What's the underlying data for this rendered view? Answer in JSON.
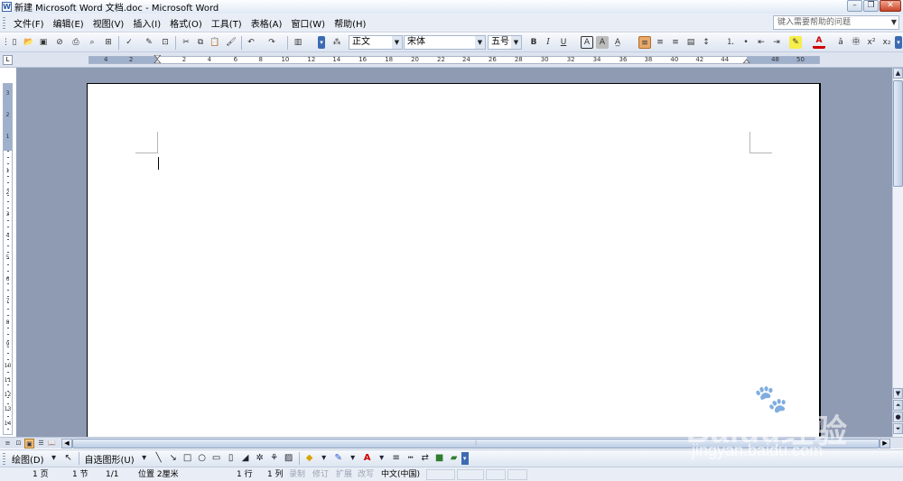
{
  "window": {
    "title": "新建 Microsoft Word 文档.doc - Microsoft Word",
    "app_icon": "W",
    "controls": [
      "minimize-icon",
      "restore-icon",
      "close-icon"
    ]
  },
  "menubar": {
    "items": [
      "文件(F)",
      "编辑(E)",
      "视图(V)",
      "插入(I)",
      "格式(O)",
      "工具(T)",
      "表格(A)",
      "窗口(W)",
      "帮助(H)"
    ],
    "help_placeholder": "键入需要帮助的问题"
  },
  "toolbar": {
    "style": "正文",
    "font": "宋体",
    "font_size": "五号",
    "bold": "B",
    "italic": "I",
    "underline": "U",
    "char_border": "A",
    "char_shading": "A",
    "font_color": "A",
    "icons": [
      "new-icon",
      "open-icon",
      "save-icon",
      "permission-icon",
      "print-icon",
      "print-preview-icon",
      "spelling-icon",
      "research-icon",
      "cut-icon",
      "copy-icon",
      "paste-icon",
      "format-painter-icon",
      "undo-icon",
      "redo-icon",
      "columns-icon",
      "styles-icon",
      "align-left-icon",
      "center-icon",
      "align-right-icon",
      "justify-icon",
      "line-spacing-icon",
      "numbering-icon",
      "bullets-icon",
      "decrease-indent-icon",
      "increase-indent-icon",
      "highlight-icon",
      "font-color-icon",
      "phonetic-guide-icon",
      "enclose-characters-icon",
      "superscript-icon"
    ]
  },
  "ruler": {
    "corner": "L",
    "horizontal_labels": [
      "4",
      "2",
      "2",
      "4",
      "6",
      "8",
      "10",
      "12",
      "14",
      "16",
      "18",
      "20",
      "22",
      "24",
      "26",
      "28",
      "30",
      "32",
      "34",
      "36",
      "38",
      "40",
      "42",
      "44",
      "48",
      "50"
    ],
    "vertical_labels": [
      "3",
      "2",
      "1",
      "1",
      "2",
      "3",
      "4",
      "5",
      "6",
      "7",
      "8",
      "9",
      "10",
      "11",
      "12",
      "13",
      "14"
    ]
  },
  "views": [
    "normal-view-icon",
    "web-layout-icon",
    "print-layout-icon",
    "outline-view-icon",
    "reading-layout-icon"
  ],
  "drawbar": {
    "draw_label": "绘图(D)",
    "autoshapes_label": "自选图形(U)",
    "icons": [
      "select-objects-icon",
      "line-icon",
      "arrow-icon",
      "rectangle-icon",
      "oval-icon",
      "text-box-icon",
      "vertical-text-box-icon",
      "wordart-icon",
      "diagram-icon",
      "clip-art-icon",
      "picture-icon",
      "fill-color-icon",
      "line-color-icon",
      "font-color-icon",
      "line-style-icon",
      "dash-style-icon",
      "arrow-style-icon",
      "shadow-icon",
      "3d-icon"
    ]
  },
  "statusbar": {
    "page": "1 页",
    "section": "1 节",
    "page_of": "1/1",
    "position": "位置 2厘米",
    "line": "1 行",
    "column": "1 列",
    "rec": "录制",
    "trk": "修订",
    "ext": "扩展",
    "ovr": "改写",
    "language": "中文(中国)"
  },
  "watermark": {
    "brand": "Baidu经验",
    "site": "jingyan.baidu.com"
  }
}
